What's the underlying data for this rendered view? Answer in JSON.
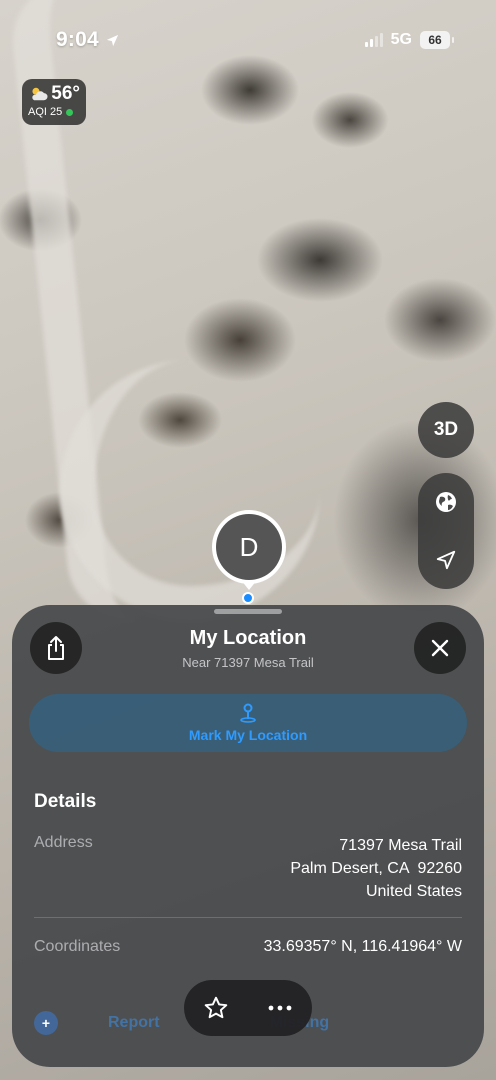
{
  "status_bar": {
    "time": "9:04",
    "network": "5G",
    "battery": "66"
  },
  "weather": {
    "temperature": "56°",
    "aqi_label": "AQI 25",
    "icon": "partly-cloudy-icon",
    "aqi_color": "#33c759"
  },
  "map_controls": {
    "mode_3d_label": "3D",
    "globe_icon": "globe-icon",
    "location_icon": "location-arrow-icon"
  },
  "pin": {
    "letter": "D"
  },
  "sheet": {
    "title": "My Location",
    "subtitle": "Near 71397 Mesa Trail",
    "mark_button_label": "Mark My Location",
    "details_heading": "Details",
    "address_label": "Address",
    "address_line1": "71397 Mesa Trail",
    "address_line2": "Palm Desert, CA  92260",
    "address_line3": "United States",
    "coordinates_label": "Coordinates",
    "coordinates_value": "33.69357° N, 116.41964° W",
    "report_label": "Report",
    "missing_label": "Missing"
  },
  "accent_color": "#2f9bff"
}
